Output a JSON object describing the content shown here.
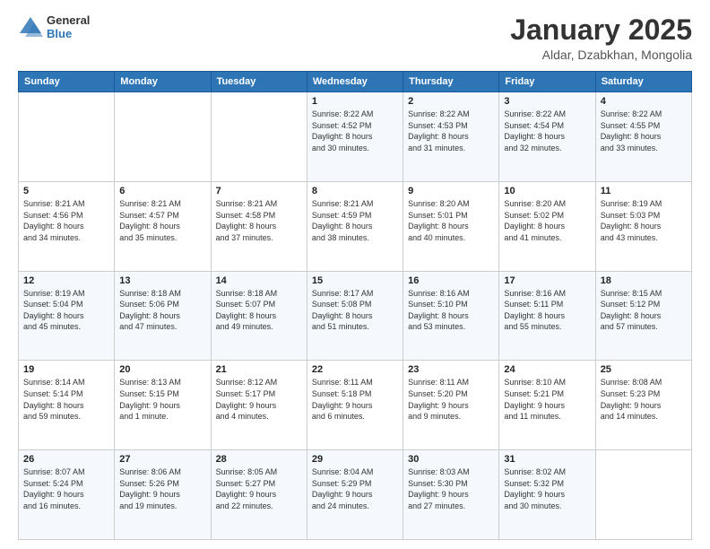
{
  "header": {
    "logo_general": "General",
    "logo_blue": "Blue",
    "title": "January 2025",
    "subtitle": "Aldar, Dzabkhan, Mongolia"
  },
  "days_of_week": [
    "Sunday",
    "Monday",
    "Tuesday",
    "Wednesday",
    "Thursday",
    "Friday",
    "Saturday"
  ],
  "weeks": [
    [
      {
        "day": "",
        "info": ""
      },
      {
        "day": "",
        "info": ""
      },
      {
        "day": "",
        "info": ""
      },
      {
        "day": "1",
        "info": "Sunrise: 8:22 AM\nSunset: 4:52 PM\nDaylight: 8 hours\nand 30 minutes."
      },
      {
        "day": "2",
        "info": "Sunrise: 8:22 AM\nSunset: 4:53 PM\nDaylight: 8 hours\nand 31 minutes."
      },
      {
        "day": "3",
        "info": "Sunrise: 8:22 AM\nSunset: 4:54 PM\nDaylight: 8 hours\nand 32 minutes."
      },
      {
        "day": "4",
        "info": "Sunrise: 8:22 AM\nSunset: 4:55 PM\nDaylight: 8 hours\nand 33 minutes."
      }
    ],
    [
      {
        "day": "5",
        "info": "Sunrise: 8:21 AM\nSunset: 4:56 PM\nDaylight: 8 hours\nand 34 minutes."
      },
      {
        "day": "6",
        "info": "Sunrise: 8:21 AM\nSunset: 4:57 PM\nDaylight: 8 hours\nand 35 minutes."
      },
      {
        "day": "7",
        "info": "Sunrise: 8:21 AM\nSunset: 4:58 PM\nDaylight: 8 hours\nand 37 minutes."
      },
      {
        "day": "8",
        "info": "Sunrise: 8:21 AM\nSunset: 4:59 PM\nDaylight: 8 hours\nand 38 minutes."
      },
      {
        "day": "9",
        "info": "Sunrise: 8:20 AM\nSunset: 5:01 PM\nDaylight: 8 hours\nand 40 minutes."
      },
      {
        "day": "10",
        "info": "Sunrise: 8:20 AM\nSunset: 5:02 PM\nDaylight: 8 hours\nand 41 minutes."
      },
      {
        "day": "11",
        "info": "Sunrise: 8:19 AM\nSunset: 5:03 PM\nDaylight: 8 hours\nand 43 minutes."
      }
    ],
    [
      {
        "day": "12",
        "info": "Sunrise: 8:19 AM\nSunset: 5:04 PM\nDaylight: 8 hours\nand 45 minutes."
      },
      {
        "day": "13",
        "info": "Sunrise: 8:18 AM\nSunset: 5:06 PM\nDaylight: 8 hours\nand 47 minutes."
      },
      {
        "day": "14",
        "info": "Sunrise: 8:18 AM\nSunset: 5:07 PM\nDaylight: 8 hours\nand 49 minutes."
      },
      {
        "day": "15",
        "info": "Sunrise: 8:17 AM\nSunset: 5:08 PM\nDaylight: 8 hours\nand 51 minutes."
      },
      {
        "day": "16",
        "info": "Sunrise: 8:16 AM\nSunset: 5:10 PM\nDaylight: 8 hours\nand 53 minutes."
      },
      {
        "day": "17",
        "info": "Sunrise: 8:16 AM\nSunset: 5:11 PM\nDaylight: 8 hours\nand 55 minutes."
      },
      {
        "day": "18",
        "info": "Sunrise: 8:15 AM\nSunset: 5:12 PM\nDaylight: 8 hours\nand 57 minutes."
      }
    ],
    [
      {
        "day": "19",
        "info": "Sunrise: 8:14 AM\nSunset: 5:14 PM\nDaylight: 8 hours\nand 59 minutes."
      },
      {
        "day": "20",
        "info": "Sunrise: 8:13 AM\nSunset: 5:15 PM\nDaylight: 9 hours\nand 1 minute."
      },
      {
        "day": "21",
        "info": "Sunrise: 8:12 AM\nSunset: 5:17 PM\nDaylight: 9 hours\nand 4 minutes."
      },
      {
        "day": "22",
        "info": "Sunrise: 8:11 AM\nSunset: 5:18 PM\nDaylight: 9 hours\nand 6 minutes."
      },
      {
        "day": "23",
        "info": "Sunrise: 8:11 AM\nSunset: 5:20 PM\nDaylight: 9 hours\nand 9 minutes."
      },
      {
        "day": "24",
        "info": "Sunrise: 8:10 AM\nSunset: 5:21 PM\nDaylight: 9 hours\nand 11 minutes."
      },
      {
        "day": "25",
        "info": "Sunrise: 8:08 AM\nSunset: 5:23 PM\nDaylight: 9 hours\nand 14 minutes."
      }
    ],
    [
      {
        "day": "26",
        "info": "Sunrise: 8:07 AM\nSunset: 5:24 PM\nDaylight: 9 hours\nand 16 minutes."
      },
      {
        "day": "27",
        "info": "Sunrise: 8:06 AM\nSunset: 5:26 PM\nDaylight: 9 hours\nand 19 minutes."
      },
      {
        "day": "28",
        "info": "Sunrise: 8:05 AM\nSunset: 5:27 PM\nDaylight: 9 hours\nand 22 minutes."
      },
      {
        "day": "29",
        "info": "Sunrise: 8:04 AM\nSunset: 5:29 PM\nDaylight: 9 hours\nand 24 minutes."
      },
      {
        "day": "30",
        "info": "Sunrise: 8:03 AM\nSunset: 5:30 PM\nDaylight: 9 hours\nand 27 minutes."
      },
      {
        "day": "31",
        "info": "Sunrise: 8:02 AM\nSunset: 5:32 PM\nDaylight: 9 hours\nand 30 minutes."
      },
      {
        "day": "",
        "info": ""
      }
    ]
  ]
}
